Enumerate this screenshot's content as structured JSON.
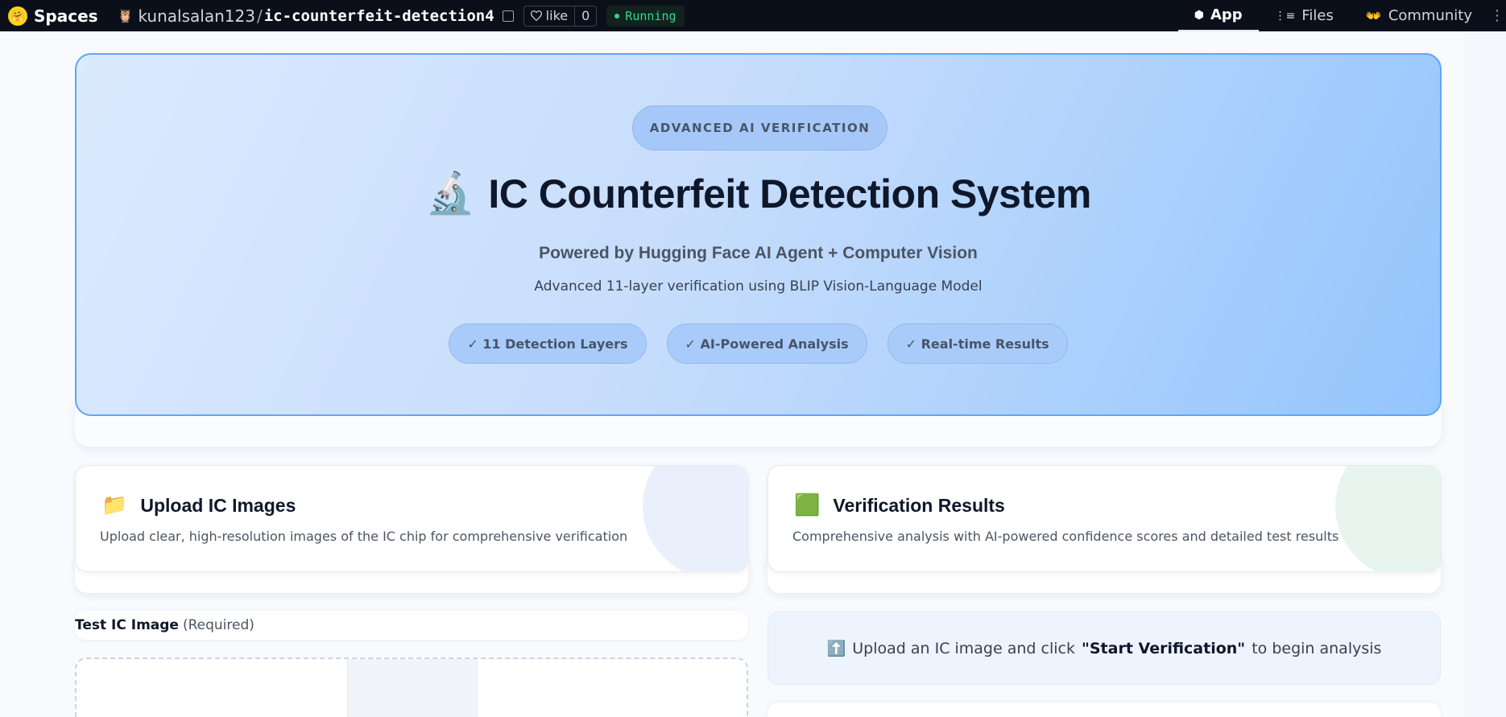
{
  "topbar": {
    "brand": "Spaces",
    "owner": "kunalsalan123",
    "separator": "/",
    "repo": "ic-counterfeit-detection4",
    "like_label": "like",
    "like_count": "0",
    "status": "Running",
    "status_color": "#34d399",
    "tabs": [
      {
        "label": "App",
        "icon": "cube-icon"
      },
      {
        "label": "Files",
        "icon": "files-icon"
      },
      {
        "label": "Community",
        "icon": "community-icon"
      }
    ]
  },
  "hero": {
    "badge": "ADVANCED AI VERIFICATION",
    "title_icon": "🔬",
    "title": "IC Counterfeit Detection System",
    "subtitle": "Powered by Hugging Face AI Agent + Computer Vision",
    "description": "Advanced 11-layer verification using BLIP Vision-Language Model",
    "features": [
      "✓ 11 Detection Layers",
      "✓ AI-Powered Analysis",
      "✓ Real-time Results"
    ],
    "accent_color": "#60a5fa"
  },
  "upload_card": {
    "icon": "📁",
    "title": "Upload IC Images",
    "description": "Upload clear, high-resolution images of the IC chip for comprehensive verification"
  },
  "results_card": {
    "icon": "🟩",
    "title": "Verification Results",
    "description": "Comprehensive analysis with AI-powered confidence scores and detailed test results"
  },
  "test_image": {
    "label": "Test IC Image",
    "required": "(Required)"
  },
  "results_message": {
    "icon": "⬆️",
    "before": "Upload an IC image and click",
    "action": "\"Start Verification\"",
    "after": "to begin analysis"
  }
}
